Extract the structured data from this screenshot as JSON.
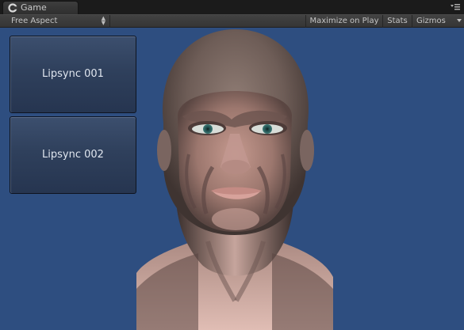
{
  "tab": {
    "title": "Game",
    "icon": "unity-logo-icon"
  },
  "toolbar": {
    "aspect_label": "Free Aspect",
    "maximize_label": "Maximize on Play",
    "stats_label": "Stats",
    "gizmos_label": "Gizmos"
  },
  "viewport": {
    "background_color": "#2e4e80",
    "buttons": [
      {
        "label": "Lipsync 001"
      },
      {
        "label": "Lipsync 002"
      }
    ]
  }
}
